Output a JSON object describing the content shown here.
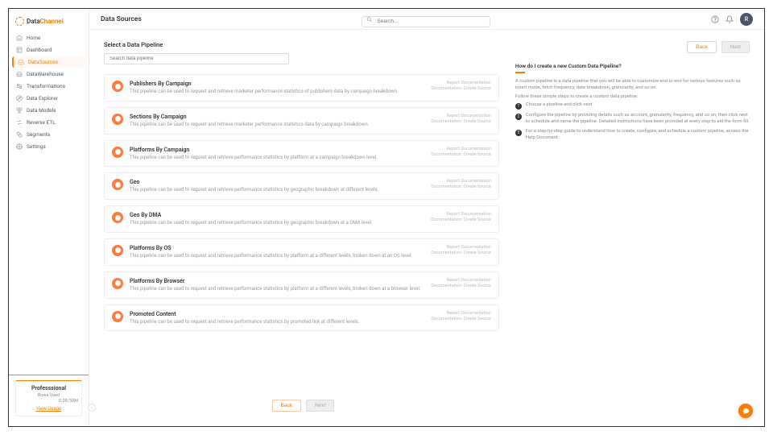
{
  "brand": {
    "first": "Data",
    "second": "Channel"
  },
  "page_title": "Data Sources",
  "search": {
    "placeholder": "Search..."
  },
  "avatar_initial": "R",
  "sidebar": {
    "items": [
      {
        "label": "Home",
        "icon": "home"
      },
      {
        "label": "Dashboard",
        "icon": "layout"
      },
      {
        "label": "DataSources",
        "icon": "inbox"
      },
      {
        "label": "DataWarehouse",
        "icon": "warehouse"
      },
      {
        "label": "Transformations",
        "icon": "transform"
      },
      {
        "label": "Data Explorer",
        "icon": "explore"
      },
      {
        "label": "Data Models",
        "icon": "model"
      },
      {
        "label": "Reverse ETL",
        "icon": "reverse"
      },
      {
        "label": "Segments",
        "icon": "segments"
      },
      {
        "label": "Settings",
        "icon": "settings"
      }
    ],
    "active_index": 2,
    "footer": {
      "plan": "Professsional",
      "rows_label": "Rows Used",
      "usage_value": "0.08/50M",
      "link": "View Usage"
    }
  },
  "center": {
    "section_label": "Select a Data Pipeline",
    "pipeline_search_placeholder": "Search data pipeline",
    "doc_label": "Report Documentation",
    "create_label": "Documentation: Create Source",
    "pipelines": [
      {
        "title": "Publishers By Campaign",
        "desc": "This pipeline can be used to request and retrieve marketer performance statistics of publishers data by campaign breakdown."
      },
      {
        "title": "Sections By Campaign",
        "desc": "This pipeline can be used to request and retrieve marketer performance statistics data by campaign breakdown."
      },
      {
        "title": "Platforms By Campaign",
        "desc": "This pipeline can be used to request and retrieve performance statistics by platform at a campaign breakdown level."
      },
      {
        "title": "Geo",
        "desc": "This pipeline can be used to request and retrieve performance statistics by geographic breakdown at different levels."
      },
      {
        "title": "Geo By DMA",
        "desc": "This pipeline can be used to request and retrieve performance statistics by geographic breakdown at a DMA level."
      },
      {
        "title": "Platforms By OS",
        "desc": "This pipeline can be used to request and retrieve performance statistics by platform at a different levels, broken down at an OS level."
      },
      {
        "title": "Platforms By Browser",
        "desc": "This pipeline can be used to request and retrieve performance statistics by platform at a different levels, broken down at a browser level."
      },
      {
        "title": "Promoted Content",
        "desc": "This pipeline can be used to request and retrieve performance statistics by promoted link at different levels."
      }
    ],
    "back_label": "Back",
    "next_label": "Next"
  },
  "help": {
    "title": "How do I create a new Custom Data Pipeline?",
    "intro": "A custom pipeline is a data pipeline that you will be able to customize end to end for various features such as insert mode, fetch frequency, date breakdown, granularity, and so on.",
    "sub": "Follow these simple steps to create a custom data pipeline:",
    "steps": [
      "Choose a pipeline and click next.",
      "Configure the pipeline by providing details such as account, granularity, frequency, and so on, then click next to schedule and name the pipeline. Detailed instructions have been provided at every step to aid the form fill.",
      "For a step-by-step guide to understand how to create, configure, and schedule a custom pipeline, access the Help Document."
    ]
  }
}
